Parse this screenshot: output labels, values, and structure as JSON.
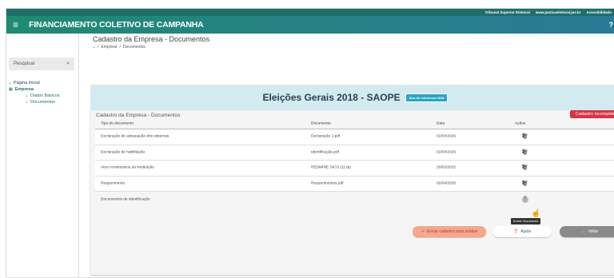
{
  "topbar": {
    "tribunal": "Tribunal Superior Eleitoral",
    "site": "www.justicaeleitoral.jus.br",
    "acessibilidade": "Acessibilidade"
  },
  "header": {
    "title": "FINANCIAMENTO COLETIVO DE CAMPANHA",
    "menu_icon": "hamburger-icon",
    "help": "?"
  },
  "sidebar": {
    "search_placeholder": "Pesquisar",
    "nav": [
      {
        "label": "Página Inicial",
        "icon": "home-icon"
      },
      {
        "label": "Empresa",
        "icon": "grid-icon"
      },
      {
        "label": "Dados Básicos",
        "icon": "home-icon"
      },
      {
        "label": "Documentos",
        "icon": "home-icon"
      }
    ]
  },
  "page": {
    "title": "Cadastro da Empresa - Documentos",
    "breadcrumb": [
      "Empresa",
      "Documentos"
    ]
  },
  "banner": {
    "title": "Eleições Gerais 2018 - SAOPE",
    "tag": "Ano de referência 2018"
  },
  "card": {
    "title": "Cadastro da Empresa - Documentos",
    "status": "Cadastro incompleto"
  },
  "table": {
    "headers": [
      "Tipo do documento",
      "Documento",
      "Data",
      "Ações"
    ],
    "rows": [
      {
        "tipo": "Declaração de adequação dos sistemas",
        "documento": "Declaração 1.pdf",
        "data": "02/04/2026"
      },
      {
        "tipo": "Declaração de habilitação",
        "documento": "Identificação.pdf",
        "data": "02/04/2026"
      },
      {
        "tipo": "Atos constitutivos da instituição",
        "documento": "REDMINE SICO (1).zip",
        "data": "20/02/2025"
      },
      {
        "tipo": "Requerimento",
        "documento": "Requerimentos.pdf",
        "data": "02/04/2026"
      },
      {
        "tipo": "Documentos de identificação",
        "documento": "",
        "data": ""
      }
    ]
  },
  "tooltip": "Enviar Documento",
  "actions": {
    "submit": "Enviar cadastro para análise",
    "help": "Ajuda",
    "back": "Voltar"
  },
  "colors": {
    "primary": "#1f6e6a",
    "header_start": "#1f8a72",
    "header_end": "#2a7a96",
    "banner": "#d3eaf0",
    "tag": "#2aa5c1",
    "incomplete": "#d63447",
    "submit": "#f2a78e"
  }
}
